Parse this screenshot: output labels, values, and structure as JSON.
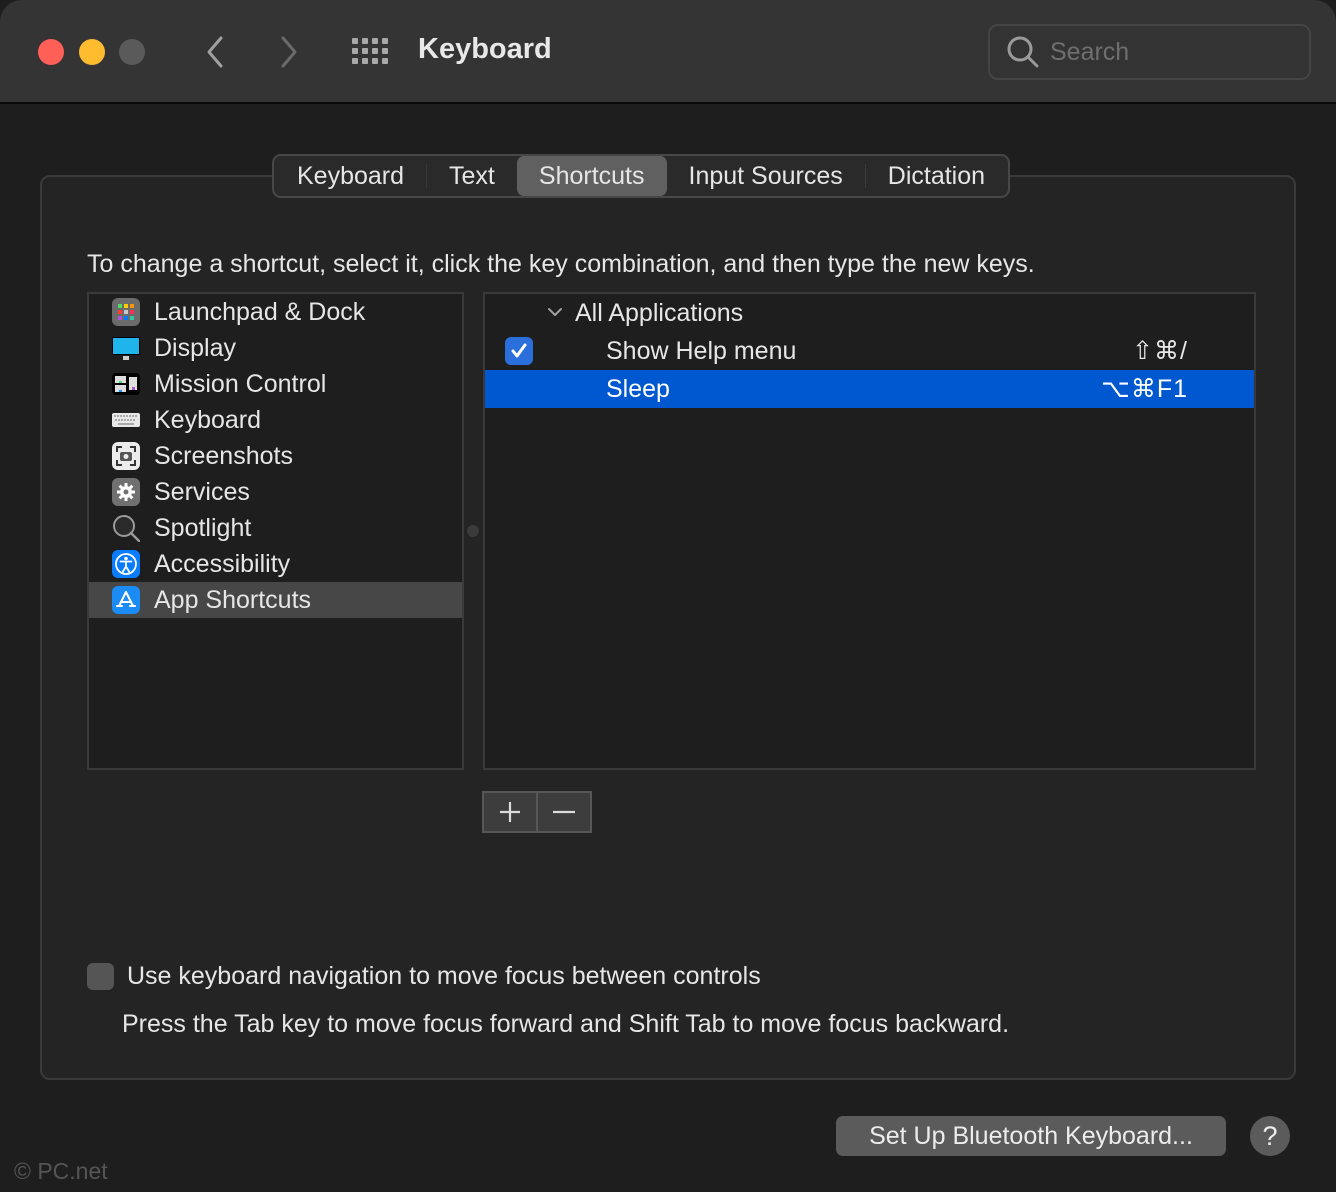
{
  "window": {
    "title": "Keyboard",
    "traffic_lights": [
      "close",
      "minimize",
      "zoom"
    ],
    "search": {
      "placeholder": "Search",
      "value": ""
    }
  },
  "tabs": [
    {
      "label": "Keyboard",
      "active": false
    },
    {
      "label": "Text",
      "active": false
    },
    {
      "label": "Shortcuts",
      "active": true
    },
    {
      "label": "Input Sources",
      "active": false
    },
    {
      "label": "Dictation",
      "active": false
    }
  ],
  "instructions": "To change a shortcut, select it, click the key combination, and then type the new keys.",
  "categories": [
    {
      "label": "Launchpad & Dock",
      "icon": "launchpad-icon",
      "selected": false
    },
    {
      "label": "Display",
      "icon": "display-icon",
      "selected": false
    },
    {
      "label": "Mission Control",
      "icon": "mission-control-icon",
      "selected": false
    },
    {
      "label": "Keyboard",
      "icon": "keyboard-icon",
      "selected": false
    },
    {
      "label": "Screenshots",
      "icon": "screenshots-icon",
      "selected": false
    },
    {
      "label": "Services",
      "icon": "gear-icon",
      "selected": false
    },
    {
      "label": "Spotlight",
      "icon": "magnifier-icon",
      "selected": false
    },
    {
      "label": "Accessibility",
      "icon": "accessibility-icon",
      "selected": false
    },
    {
      "label": "App Shortcuts",
      "icon": "app-store-icon",
      "selected": true
    }
  ],
  "shortcuts": {
    "group_label": "All Applications",
    "items": [
      {
        "name": "Show Help menu",
        "keys": "⇧⌘/",
        "checked": true,
        "selected": false
      },
      {
        "name": "Sleep",
        "keys": "⌥⌘F1",
        "checked": false,
        "selected": true
      }
    ]
  },
  "buttons": {
    "add": "+",
    "remove": "−",
    "bluetooth": "Set Up Bluetooth Keyboard...",
    "help": "?"
  },
  "keyboard_navigation": {
    "label": "Use keyboard navigation to move focus between controls",
    "checked": false,
    "hint": "Press the Tab key to move focus forward and Shift Tab to move focus backward."
  },
  "watermark": "© PC.net",
  "colors": {
    "selection": "#0058d0",
    "checkbox": "#2a6fdc",
    "close": "#fe5f57",
    "minimize": "#febc2e"
  }
}
